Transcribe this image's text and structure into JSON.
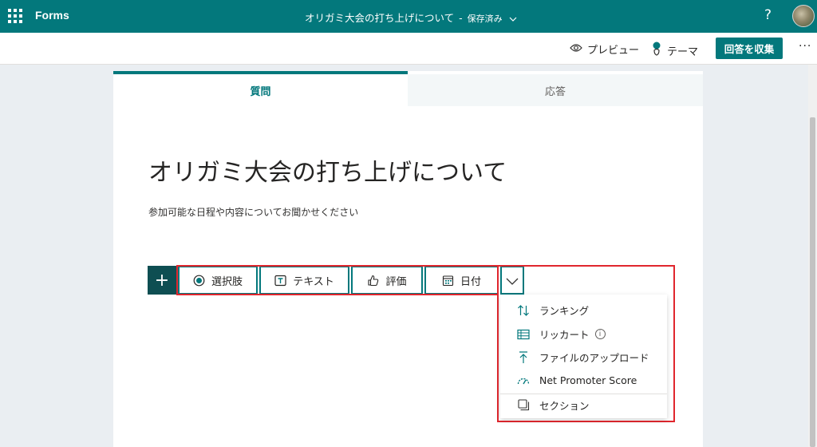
{
  "topbar": {
    "app_name": "Forms",
    "doc_title": "オリガミ大会の打ち上げについて",
    "separator": "-",
    "saved_status": "保存済み",
    "help": "?"
  },
  "commandbar": {
    "preview": "プレビュー",
    "theme": "テーマ",
    "collect": "回答を収集",
    "more": "···"
  },
  "tabs": {
    "questions": "質問",
    "responses": "応答"
  },
  "form": {
    "title": "オリガミ大会の打ち上げについて",
    "description": "参加可能な日程や内容についてお聞かせください"
  },
  "add_question": {
    "plus": "+",
    "choice": "選択肢",
    "text": "テキスト",
    "rating": "評価",
    "date": "日付"
  },
  "more_types": {
    "ranking": "ランキング",
    "likert": "リッカート",
    "file_upload": "ファイルのアップロード",
    "nps": "Net Promoter Score",
    "section": "セクション"
  },
  "colors": {
    "brand": "#03787c",
    "highlight": "#e0262d"
  }
}
